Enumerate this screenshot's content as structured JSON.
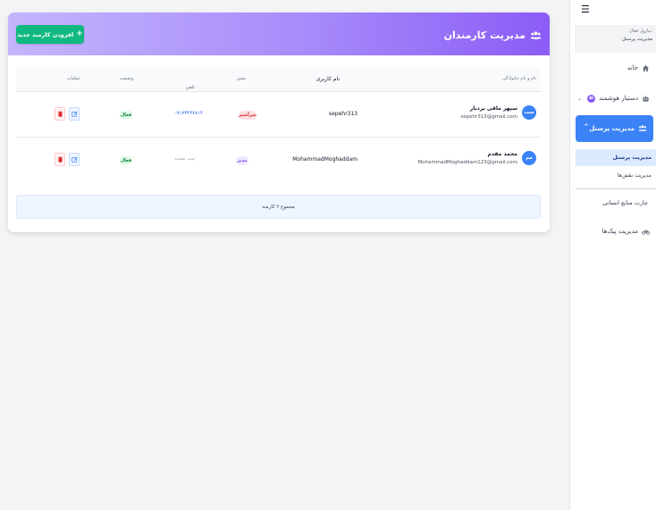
{
  "header": {
    "title": "مدیریت کارمندان",
    "add_button_label": "افزودن کارمند جدید"
  },
  "table": {
    "columns": [
      "نام و نام خانوادگی",
      "نام کاربری",
      "نقش",
      "تلفن",
      "وضعیت",
      "عملیات"
    ],
    "rows": [
      {
        "avatar": "سب",
        "full_name": "سپهر ماقی بردبار",
        "email": "sepehr313@gmail.com",
        "username": "sepehr313",
        "role": "سرآشپز",
        "phone": "۰۹۱۷۳۴۴۷۸۱۴",
        "status": "فعال"
      },
      {
        "avatar": "مم",
        "full_name": "محمد مقدم",
        "email": "MohammadMoghaddam123@gmail.com",
        "username": "MohammadMoghaddam",
        "role": "مدیر",
        "phone": "ثبت نشده",
        "status": "فعال"
      }
    ],
    "footer": "مجموع ۲ کارمند"
  },
  "sidebar": {
    "module_caption": "ماژول فعال:",
    "module_value": "مدیریت پرسنل",
    "items": [
      {
        "label": "خانه",
        "icon": "home-icon"
      },
      {
        "label": "دستیار هوشمند",
        "icon": "robot-icon",
        "badge": "AI"
      },
      {
        "label": "مدیریت پرسنل",
        "icon": "users-icon",
        "active": true
      },
      {
        "label": "مدیریت پیک‌ها",
        "icon": "bicycle-icon"
      }
    ],
    "sub_items": [
      {
        "label": "مدیریت پرسنل",
        "active": true
      },
      {
        "label": "مدیریت نقش‌ها"
      }
    ],
    "chart_label": "چارت منابع انسانی"
  },
  "colors": {
    "header_gradient_start": "#c4b5fd",
    "header_gradient_end": "#8b5cf6",
    "add_button": "#10b981",
    "sidebar_active": "#3b82f6",
    "status_active": "#15803d"
  }
}
